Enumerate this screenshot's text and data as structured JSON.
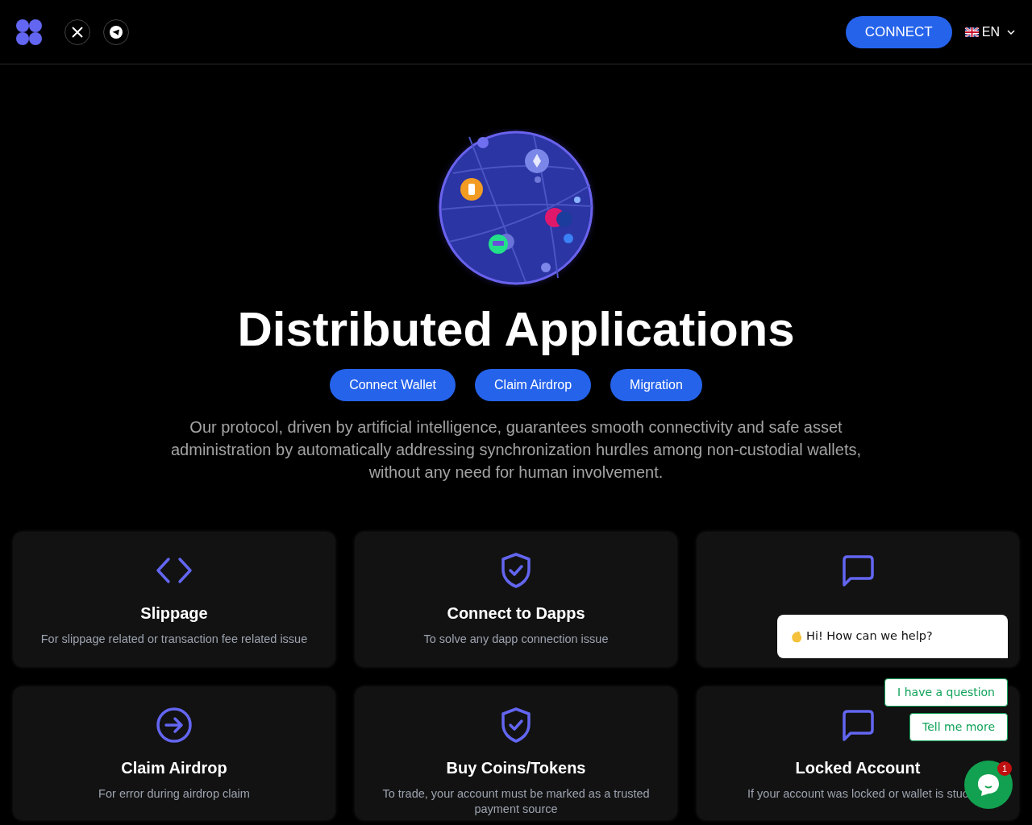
{
  "header": {
    "connect_button": "CONNECT",
    "language": "EN"
  },
  "hero": {
    "title": "Distributed Applications",
    "buttons": [
      "Connect Wallet",
      "Claim Airdrop",
      "Migration"
    ],
    "description": "Our protocol, driven by artificial intelligence, guarantees smooth connectivity and safe asset administration by automatically addressing synchronization hurdles among non-custodial wallets, without any need for human involvement."
  },
  "cards": [
    {
      "kind": "code",
      "title": "Slippage",
      "description": "For slippage related or transaction fee related issue"
    },
    {
      "kind": "shield",
      "title": "Connect to Dapps",
      "description": "To solve any dapp connection issue"
    },
    {
      "kind": "chat"
    },
    {
      "kind": "arrow",
      "title": "Claim Airdrop",
      "description": "For error during airdrop claim"
    },
    {
      "kind": "shield",
      "title": "Buy Coins/Tokens",
      "description": "To trade, your account must be marked as a trusted payment source"
    },
    {
      "kind": "chat",
      "title": "Locked Account",
      "description": "If your account was locked or wallet is stuc"
    }
  ],
  "chat": {
    "greeting": "Hi! How can we help?",
    "replies": [
      "I have a question",
      "Tell me more"
    ],
    "unread": "1"
  }
}
